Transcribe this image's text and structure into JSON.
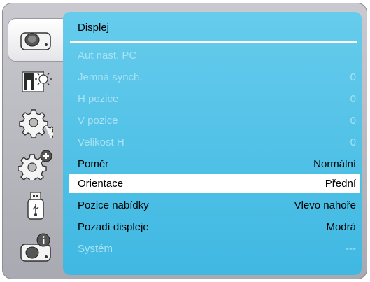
{
  "menu": {
    "title": "Displej",
    "items": [
      {
        "label": "Aut nast. PC",
        "value": "",
        "state": "disabled"
      },
      {
        "label": "Jemná synch.",
        "value": "0",
        "state": "disabled"
      },
      {
        "label": "H pozice",
        "value": "0",
        "state": "disabled"
      },
      {
        "label": "V pozice",
        "value": "0",
        "state": "disabled"
      },
      {
        "label": "Velikost H",
        "value": "0",
        "state": "disabled"
      },
      {
        "label": "Poměr",
        "value": "Normální",
        "state": "enabled"
      },
      {
        "label": "Orientace",
        "value": "Přední",
        "state": "selected"
      },
      {
        "label": "Pozice nabídky",
        "value": "Vlevo nahoře",
        "state": "enabled"
      },
      {
        "label": "Pozadí displeje",
        "value": "Modrá",
        "state": "enabled"
      },
      {
        "label": "Systém",
        "value": "---",
        "state": "disabled"
      }
    ]
  },
  "sidebar": {
    "icons": [
      {
        "name": "projector-display-icon",
        "active": true
      },
      {
        "name": "picture-brightness-icon",
        "active": false
      },
      {
        "name": "settings-gear-icon",
        "active": false
      },
      {
        "name": "advanced-settings-gear-plus-icon",
        "active": false
      },
      {
        "name": "usb-icon",
        "active": false
      },
      {
        "name": "projector-info-icon",
        "active": false
      }
    ]
  },
  "colors": {
    "menu_background": "#4dc0e8",
    "selected_row": "#ffffff",
    "disabled_text": "#a8e2f4",
    "frame": "#b8b8c0"
  }
}
